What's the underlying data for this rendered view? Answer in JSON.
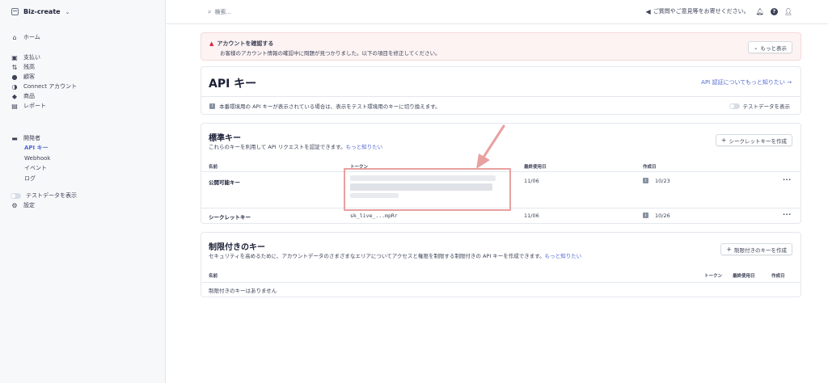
{
  "sidebar": {
    "brand": "Biz-create",
    "items": [
      {
        "icon": "home-icon",
        "glyph": "⌂",
        "label": "ホーム"
      },
      {
        "icon": "payments-icon",
        "glyph": "▣",
        "label": "支払い"
      },
      {
        "icon": "balance-icon",
        "glyph": "⇅",
        "label": "残高"
      },
      {
        "icon": "customers-icon",
        "glyph": "●",
        "label": "顧客"
      },
      {
        "icon": "connect-icon",
        "glyph": "◑",
        "label": "Connect アカウント"
      },
      {
        "icon": "products-icon",
        "glyph": "◆",
        "label": "商品"
      },
      {
        "icon": "reports-icon",
        "glyph": "▤",
        "label": "レポート"
      }
    ],
    "developers": {
      "label": "開発者",
      "subitems": [
        "API キー",
        "Webhook",
        "イベント",
        "ログ"
      ]
    },
    "test_data_label": "テストデータを表示",
    "settings_label": "設定"
  },
  "topbar": {
    "search_placeholder": "検索...",
    "feedback": "ご質問やご意見等をお寄せください。"
  },
  "alert": {
    "title": "アカウントを確認する",
    "text": "お客様のアカウント情報の確認中に問題が見つかりました。以下の項目を修正してください。",
    "button": "もっと表示"
  },
  "api": {
    "title": "API キー",
    "link": "API 認証についてもっと知りたい →",
    "note": "本番環境用の API キーが表示されている場合は、表示をテスト環境用のキーに切り換えます。",
    "test_toggle": "テストデータを表示"
  },
  "standard": {
    "title": "標準キー",
    "desc": "これらのキーを利用して API リクエストを認証できます。",
    "desc_link": "もっと知りたい",
    "create_button": "シークレットキーを作成",
    "columns": {
      "name": "名前",
      "token": "トークン",
      "last_used": "最終使用日",
      "created": "作成日"
    },
    "rows": [
      {
        "name": "公開可能キー",
        "token": "",
        "last_used": "11/06",
        "created": "10/23"
      },
      {
        "name": "シークレットキー",
        "token": "sk_live_...mpRr",
        "last_used": "11/06",
        "created": "10/26"
      }
    ]
  },
  "restricted": {
    "title": "制限付きのキー",
    "desc": "セキュリティを高めるために、アカウントデータのさまざまなエリアについてアクセスと権限を制限する制限付きの API キーを作成できます。",
    "desc_link": "もっと知りたい",
    "create_button": "制限付きのキーを作成",
    "columns": {
      "name": "名前",
      "token": "トークン",
      "last_used": "最終使用日",
      "created": "作成日"
    },
    "empty": "制限付きのキーはありません"
  },
  "colors": {
    "accent": "#5469d4",
    "alert_bg": "#fdf3f3",
    "highlight": "#e8a0a0"
  }
}
